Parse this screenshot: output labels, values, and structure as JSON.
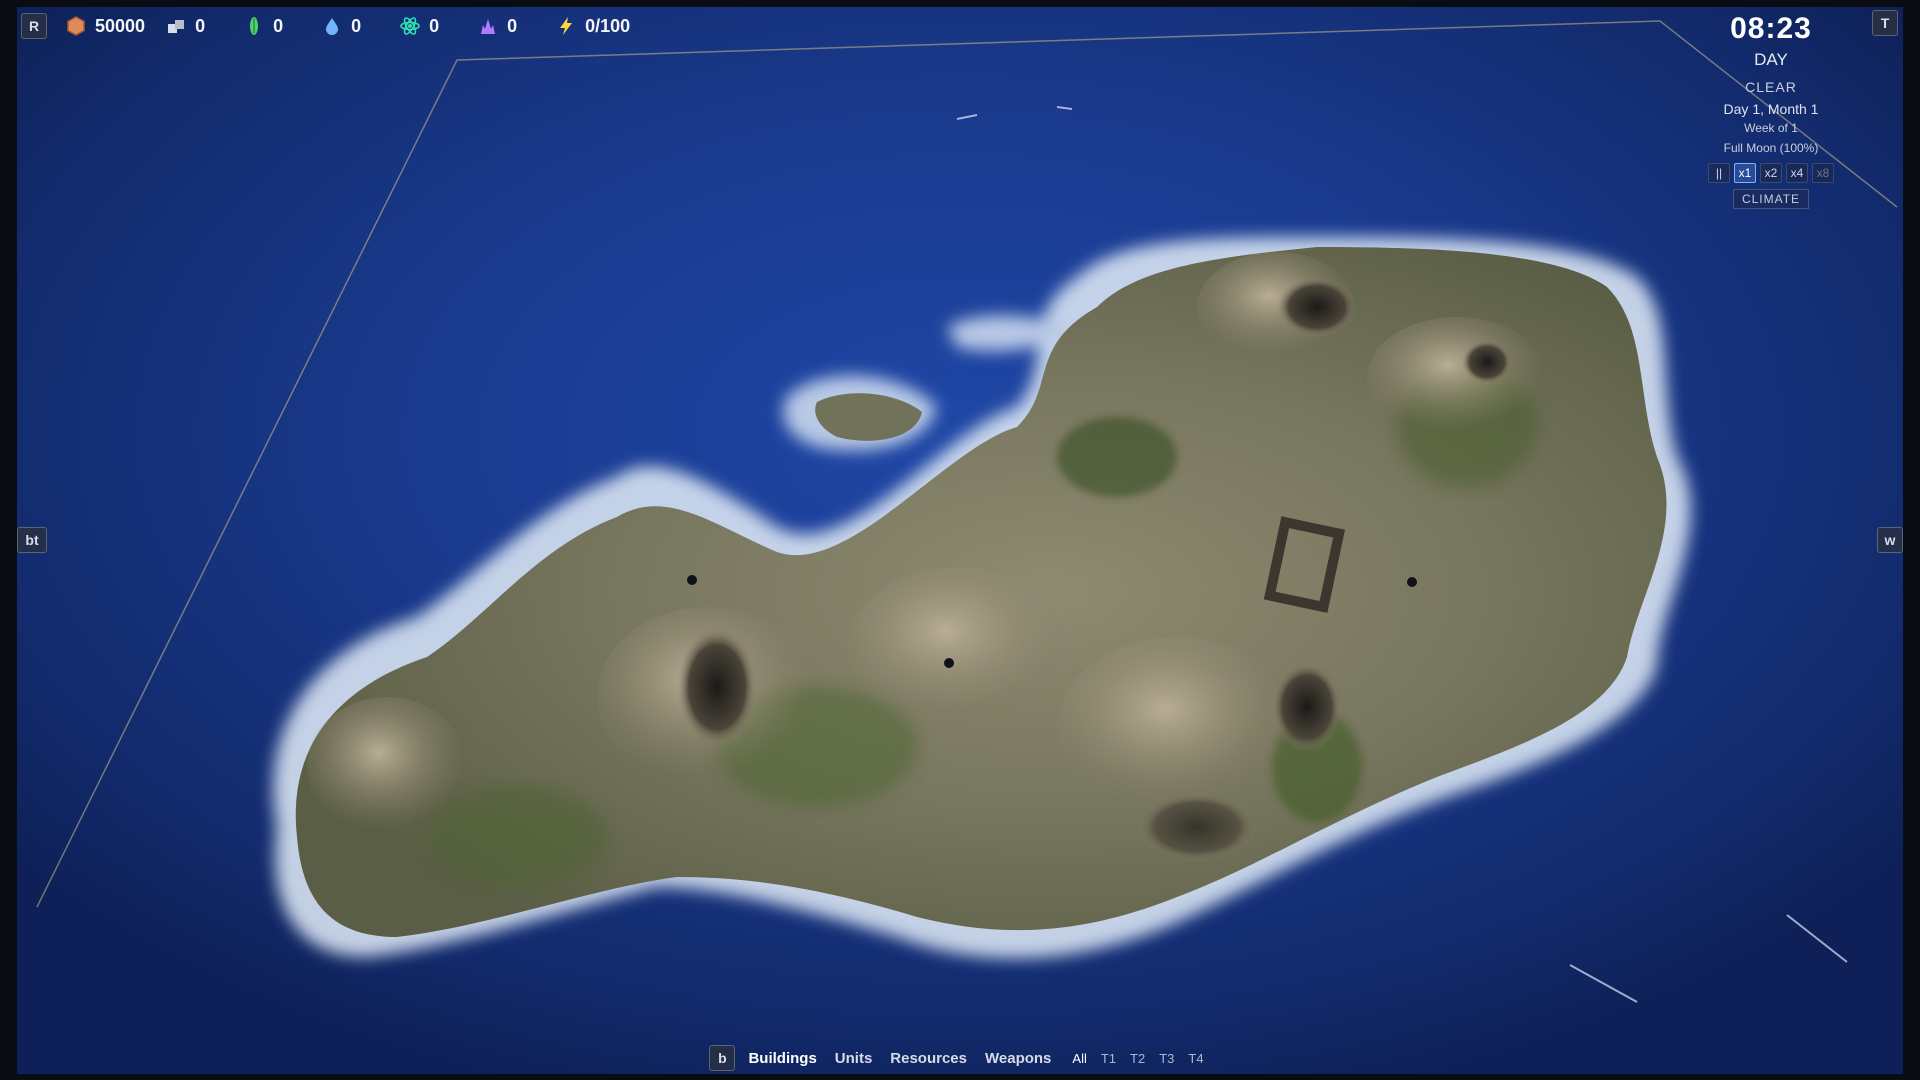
{
  "top_bar": {
    "left_badge": "R",
    "right_badge": "T",
    "resources": [
      {
        "name": "hex-credits",
        "icon": "hexagon-icon",
        "value": "50000",
        "color": "#e0895a"
      },
      {
        "name": "stone",
        "icon": "stone-icon",
        "value": "0",
        "color": "#d8dde6"
      },
      {
        "name": "biomass",
        "icon": "leaf-icon",
        "value": "0",
        "color": "#4fd36a"
      },
      {
        "name": "water",
        "icon": "droplet-icon",
        "value": "0",
        "color": "#6fb6ff"
      },
      {
        "name": "atomic",
        "icon": "atom-icon",
        "value": "0",
        "color": "#2fe0b0"
      },
      {
        "name": "crystal",
        "icon": "crystal-icon",
        "value": "0",
        "color": "#b07cff"
      },
      {
        "name": "power",
        "icon": "lightning-icon",
        "value": "0/100",
        "color": "#ffd83a"
      }
    ]
  },
  "clock": {
    "time": "08:23",
    "period": "DAY",
    "weather": "CLEAR",
    "date": "Day 1, Month 1",
    "week": "Week of 1",
    "moon": "Full Moon (100%)",
    "speeds": [
      "||",
      "x1",
      "x2",
      "x4",
      "x8"
    ],
    "active_speed": "x1",
    "climate_label": "CLIMATE"
  },
  "side": {
    "left_badge": "bt",
    "right_badge": "w"
  },
  "bottom_bar": {
    "key_badge": "b",
    "tabs": [
      "Buildings",
      "Units",
      "Resources",
      "Weapons"
    ],
    "tiers": [
      "All",
      "T1",
      "T2",
      "T3",
      "T4"
    ]
  }
}
